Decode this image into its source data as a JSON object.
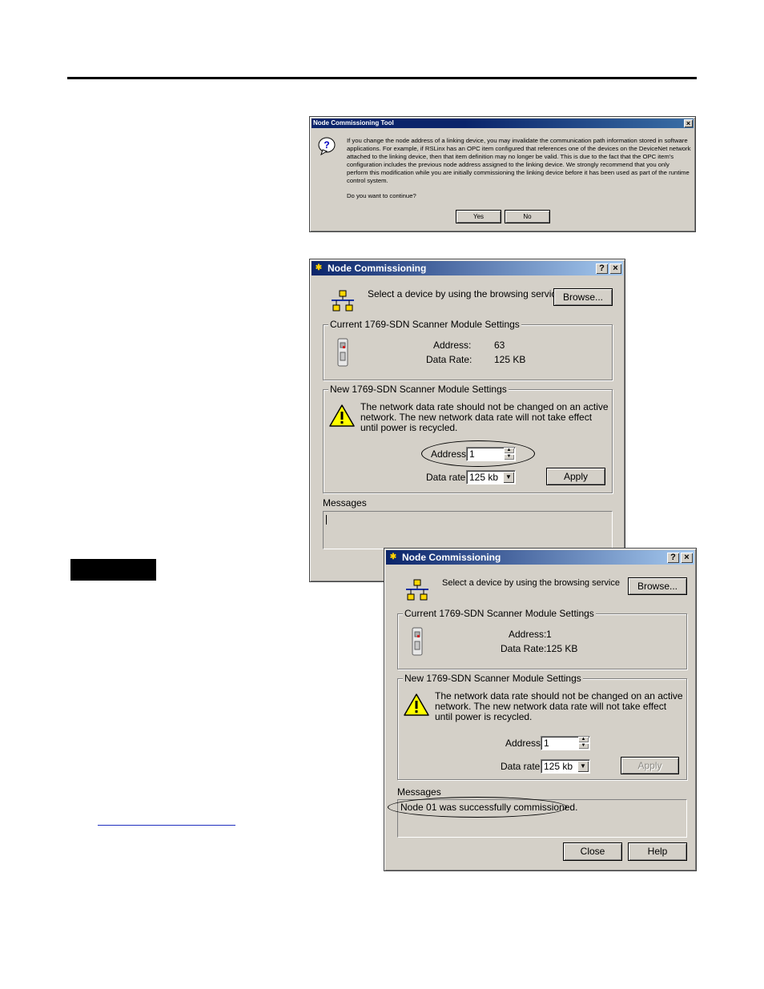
{
  "confirm_dialog": {
    "title": "Node Commissioning Tool",
    "close_label": "×",
    "message": "If you change the node address of a linking device, you may invalidate the communication path information stored in software applications. For example, if RSLinx has an OPC item configured that references one of the devices on the DeviceNet network attached to the linking device, then that item definition may no longer be valid. This is due to the fact that the OPC item's configuration includes the previous node address assigned to the linking device. We strongly recommend that you only perform this modification while you are initially commissioning the linking device before it has been used as part of the runtime control system.",
    "question": "Do you want to continue?",
    "yes_label": "Yes",
    "no_label": "No"
  },
  "window_before": {
    "title": "Node Commissioning",
    "help_btn": "?",
    "close_btn": "×",
    "browse_prompt": "Select a device by using the browsing service",
    "browse_label": "Browse...",
    "current_group": "Current 1769-SDN Scanner Module Settings",
    "address_caption": "Address:",
    "address_value": "63",
    "rate_caption": "Data Rate:",
    "rate_value": "125 KB",
    "new_group": "New 1769-SDN Scanner Module Settings",
    "warning": "The network data rate should not be changed on an active network. The new network data rate will not take effect until power is recycled.",
    "address_label": "Address",
    "address_input": "1",
    "data_rate_label": "Data rate",
    "data_rate_select": "125 kb",
    "apply_label": "Apply",
    "messages_label": "Messages",
    "message_text": ""
  },
  "window_after": {
    "title": "Node Commissioning",
    "help_btn": "?",
    "close_btn": "×",
    "browse_prompt": "Select a device by using the browsing service",
    "browse_label": "Browse...",
    "current_group": "Current 1769-SDN Scanner Module Settings",
    "address_caption": "Address:",
    "address_value": "1",
    "rate_caption": "Data Rate:",
    "rate_value": "125 KB",
    "new_group": "New 1769-SDN Scanner Module Settings",
    "warning": "The network data rate should not be changed on an active network. The new network data rate will not take effect until power is recycled.",
    "address_label": "Address",
    "address_input": "1",
    "data_rate_label": "Data rate",
    "data_rate_select": "125 kb",
    "apply_label": "Apply",
    "messages_label": "Messages",
    "message_text": "Node 01 was successfully commissioned.",
    "close_label": "Close",
    "help_label": "Help"
  },
  "icons": {
    "question": "question-icon",
    "network": "network-icon",
    "module": "scanner-module-icon",
    "warning": "warning-icon",
    "spin_up": "▲",
    "spin_down": "▼",
    "drop": "▼"
  }
}
